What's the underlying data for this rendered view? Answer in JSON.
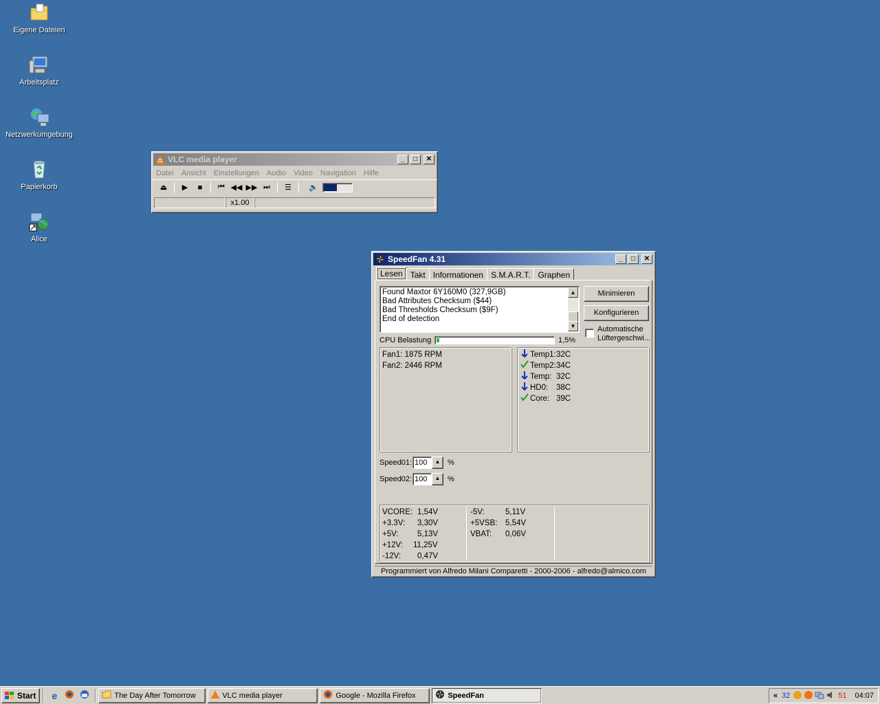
{
  "desktop": {
    "icons": [
      {
        "label": "Eigene Dateien",
        "icon": "folder-icon"
      },
      {
        "label": "Arbeitsplatz",
        "icon": "computer-icon"
      },
      {
        "label": "Netzwerkumgebung",
        "icon": "network-icon"
      },
      {
        "label": "Papierkorb",
        "icon": "recycle-bin-icon"
      },
      {
        "label": "Alice",
        "icon": "shortcut-icon"
      }
    ]
  },
  "vlc": {
    "title": "VLC media player",
    "menu": [
      "Datei",
      "Ansicht",
      "Einstellungen",
      "Audio",
      "Video",
      "Navigation",
      "Hilfe"
    ],
    "speed": "x1.00",
    "volume_level": 0.45
  },
  "speedfan": {
    "title": "SpeedFan 4.31",
    "tabs": [
      "Lesen",
      "Takt",
      "Informationen",
      "S.M.A.R.T.",
      "Graphen"
    ],
    "log": [
      "Found Maxtor 6Y160M0 (327,9GB)",
      "Bad Attributes Checksum ($44)",
      "Bad Thresholds Checksum ($9F)",
      "End of detection"
    ],
    "btn_minimize": "Minimieren",
    "btn_configure": "Konfigurieren",
    "auto_fan_label_1": "Automatische",
    "auto_fan_label_2": "Lüftergeschwi...",
    "cpu_label": "CPU Belastung",
    "cpu_value": "1,5%",
    "cpu_fraction": 0.015,
    "fans": [
      "Fan1: 1875 RPM",
      "Fan2: 2446 RPM"
    ],
    "temps": [
      {
        "status": "down",
        "name": "Temp1:",
        "value": "32C"
      },
      {
        "status": "ok",
        "name": "Temp2:",
        "value": "34C"
      },
      {
        "status": "down",
        "name": "Temp:",
        "value": "32C"
      },
      {
        "status": "down",
        "name": "HD0:",
        "value": "38C"
      },
      {
        "status": "ok",
        "name": "Core:",
        "value": "39C"
      }
    ],
    "speeds": [
      {
        "label": "Speed01:",
        "value": "100",
        "unit": "%"
      },
      {
        "label": "Speed02:",
        "value": "100",
        "unit": "%"
      }
    ],
    "voltages_left": [
      {
        "name": "VCORE:",
        "value": "1,54V"
      },
      {
        "name": "+3.3V:",
        "value": "3,30V"
      },
      {
        "name": "+5V:",
        "value": "5,13V"
      },
      {
        "name": "+12V:",
        "value": "11,25V"
      },
      {
        "name": "-12V:",
        "value": "0,47V"
      }
    ],
    "voltages_right": [
      {
        "name": "-5V:",
        "value": "5,11V"
      },
      {
        "name": "+5VSB:",
        "value": "5,54V"
      },
      {
        "name": "VBAT:",
        "value": "0,06V"
      }
    ],
    "footer": "Programmiert von Alfredo Milani Comparetti - 2000-2006 - alfredo@almico.com"
  },
  "taskbar": {
    "start": "Start",
    "tasks": [
      "The Day After Tomorrow",
      "VLC media player",
      "Google - Mozilla Firefox",
      "SpeedFan"
    ],
    "tray_left": "32",
    "tray_right": "51",
    "clock": "04:07"
  },
  "colors": {
    "desktop": "#3a6ea5",
    "active_title": "#0a246a",
    "progress": "#22c032"
  }
}
